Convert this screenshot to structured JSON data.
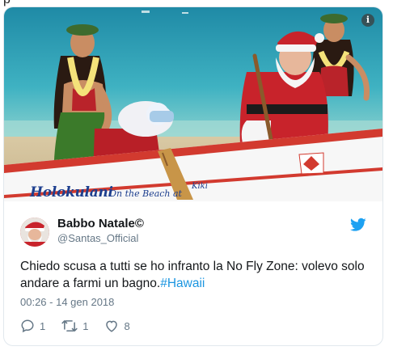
{
  "page": {
    "partial_top_text": "p"
  },
  "media": {
    "photo_alt": "Santa in an outrigger canoe on Waikiki beach",
    "canoe_brand": "Holokulani",
    "canoe_sub": "On the Beach at",
    "canoe_tail": "Kiki",
    "info_icon": "i"
  },
  "tweet": {
    "display_name": "Babbo Natale©",
    "handle": "@Santas_Official",
    "text_main": "Chiedo scusa a tutti se ho infranto la No Fly Zone: volevo solo andare a farmi un bagno.",
    "hashtag": "#Hawaii",
    "timestamp": "00:26 - 14 gen 2018",
    "replies": "1",
    "retweets": "1",
    "likes": "8"
  },
  "colors": {
    "twitter_blue": "#1da1f2",
    "hashtag_blue": "#1b95e0",
    "muted_gray": "#657786",
    "canoe_red": "#d23a2f"
  },
  "icons": {
    "logo": "twitter-bird-icon",
    "reply": "reply-icon",
    "retweet": "retweet-icon",
    "like": "heart-icon",
    "info": "info-icon"
  }
}
